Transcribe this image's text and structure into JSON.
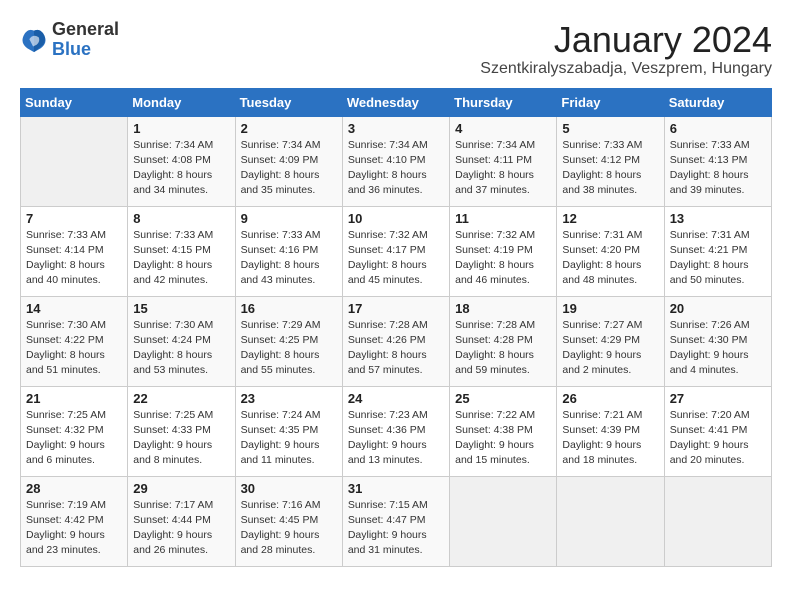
{
  "logo": {
    "general": "General",
    "blue": "Blue"
  },
  "title": "January 2024",
  "location": "Szentkiralyszabadja, Veszprem, Hungary",
  "days_of_week": [
    "Sunday",
    "Monday",
    "Tuesday",
    "Wednesday",
    "Thursday",
    "Friday",
    "Saturday"
  ],
  "weeks": [
    [
      {
        "day": "",
        "sunrise": "",
        "sunset": "",
        "daylight": ""
      },
      {
        "day": "1",
        "sunrise": "Sunrise: 7:34 AM",
        "sunset": "Sunset: 4:08 PM",
        "daylight": "Daylight: 8 hours and 34 minutes."
      },
      {
        "day": "2",
        "sunrise": "Sunrise: 7:34 AM",
        "sunset": "Sunset: 4:09 PM",
        "daylight": "Daylight: 8 hours and 35 minutes."
      },
      {
        "day": "3",
        "sunrise": "Sunrise: 7:34 AM",
        "sunset": "Sunset: 4:10 PM",
        "daylight": "Daylight: 8 hours and 36 minutes."
      },
      {
        "day": "4",
        "sunrise": "Sunrise: 7:34 AM",
        "sunset": "Sunset: 4:11 PM",
        "daylight": "Daylight: 8 hours and 37 minutes."
      },
      {
        "day": "5",
        "sunrise": "Sunrise: 7:33 AM",
        "sunset": "Sunset: 4:12 PM",
        "daylight": "Daylight: 8 hours and 38 minutes."
      },
      {
        "day": "6",
        "sunrise": "Sunrise: 7:33 AM",
        "sunset": "Sunset: 4:13 PM",
        "daylight": "Daylight: 8 hours and 39 minutes."
      }
    ],
    [
      {
        "day": "7",
        "sunrise": "Sunrise: 7:33 AM",
        "sunset": "Sunset: 4:14 PM",
        "daylight": "Daylight: 8 hours and 40 minutes."
      },
      {
        "day": "8",
        "sunrise": "Sunrise: 7:33 AM",
        "sunset": "Sunset: 4:15 PM",
        "daylight": "Daylight: 8 hours and 42 minutes."
      },
      {
        "day": "9",
        "sunrise": "Sunrise: 7:33 AM",
        "sunset": "Sunset: 4:16 PM",
        "daylight": "Daylight: 8 hours and 43 minutes."
      },
      {
        "day": "10",
        "sunrise": "Sunrise: 7:32 AM",
        "sunset": "Sunset: 4:17 PM",
        "daylight": "Daylight: 8 hours and 45 minutes."
      },
      {
        "day": "11",
        "sunrise": "Sunrise: 7:32 AM",
        "sunset": "Sunset: 4:19 PM",
        "daylight": "Daylight: 8 hours and 46 minutes."
      },
      {
        "day": "12",
        "sunrise": "Sunrise: 7:31 AM",
        "sunset": "Sunset: 4:20 PM",
        "daylight": "Daylight: 8 hours and 48 minutes."
      },
      {
        "day": "13",
        "sunrise": "Sunrise: 7:31 AM",
        "sunset": "Sunset: 4:21 PM",
        "daylight": "Daylight: 8 hours and 50 minutes."
      }
    ],
    [
      {
        "day": "14",
        "sunrise": "Sunrise: 7:30 AM",
        "sunset": "Sunset: 4:22 PM",
        "daylight": "Daylight: 8 hours and 51 minutes."
      },
      {
        "day": "15",
        "sunrise": "Sunrise: 7:30 AM",
        "sunset": "Sunset: 4:24 PM",
        "daylight": "Daylight: 8 hours and 53 minutes."
      },
      {
        "day": "16",
        "sunrise": "Sunrise: 7:29 AM",
        "sunset": "Sunset: 4:25 PM",
        "daylight": "Daylight: 8 hours and 55 minutes."
      },
      {
        "day": "17",
        "sunrise": "Sunrise: 7:28 AM",
        "sunset": "Sunset: 4:26 PM",
        "daylight": "Daylight: 8 hours and 57 minutes."
      },
      {
        "day": "18",
        "sunrise": "Sunrise: 7:28 AM",
        "sunset": "Sunset: 4:28 PM",
        "daylight": "Daylight: 8 hours and 59 minutes."
      },
      {
        "day": "19",
        "sunrise": "Sunrise: 7:27 AM",
        "sunset": "Sunset: 4:29 PM",
        "daylight": "Daylight: 9 hours and 2 minutes."
      },
      {
        "day": "20",
        "sunrise": "Sunrise: 7:26 AM",
        "sunset": "Sunset: 4:30 PM",
        "daylight": "Daylight: 9 hours and 4 minutes."
      }
    ],
    [
      {
        "day": "21",
        "sunrise": "Sunrise: 7:25 AM",
        "sunset": "Sunset: 4:32 PM",
        "daylight": "Daylight: 9 hours and 6 minutes."
      },
      {
        "day": "22",
        "sunrise": "Sunrise: 7:25 AM",
        "sunset": "Sunset: 4:33 PM",
        "daylight": "Daylight: 9 hours and 8 minutes."
      },
      {
        "day": "23",
        "sunrise": "Sunrise: 7:24 AM",
        "sunset": "Sunset: 4:35 PM",
        "daylight": "Daylight: 9 hours and 11 minutes."
      },
      {
        "day": "24",
        "sunrise": "Sunrise: 7:23 AM",
        "sunset": "Sunset: 4:36 PM",
        "daylight": "Daylight: 9 hours and 13 minutes."
      },
      {
        "day": "25",
        "sunrise": "Sunrise: 7:22 AM",
        "sunset": "Sunset: 4:38 PM",
        "daylight": "Daylight: 9 hours and 15 minutes."
      },
      {
        "day": "26",
        "sunrise": "Sunrise: 7:21 AM",
        "sunset": "Sunset: 4:39 PM",
        "daylight": "Daylight: 9 hours and 18 minutes."
      },
      {
        "day": "27",
        "sunrise": "Sunrise: 7:20 AM",
        "sunset": "Sunset: 4:41 PM",
        "daylight": "Daylight: 9 hours and 20 minutes."
      }
    ],
    [
      {
        "day": "28",
        "sunrise": "Sunrise: 7:19 AM",
        "sunset": "Sunset: 4:42 PM",
        "daylight": "Daylight: 9 hours and 23 minutes."
      },
      {
        "day": "29",
        "sunrise": "Sunrise: 7:17 AM",
        "sunset": "Sunset: 4:44 PM",
        "daylight": "Daylight: 9 hours and 26 minutes."
      },
      {
        "day": "30",
        "sunrise": "Sunrise: 7:16 AM",
        "sunset": "Sunset: 4:45 PM",
        "daylight": "Daylight: 9 hours and 28 minutes."
      },
      {
        "day": "31",
        "sunrise": "Sunrise: 7:15 AM",
        "sunset": "Sunset: 4:47 PM",
        "daylight": "Daylight: 9 hours and 31 minutes."
      },
      {
        "day": "",
        "sunrise": "",
        "sunset": "",
        "daylight": ""
      },
      {
        "day": "",
        "sunrise": "",
        "sunset": "",
        "daylight": ""
      },
      {
        "day": "",
        "sunrise": "",
        "sunset": "",
        "daylight": ""
      }
    ]
  ]
}
